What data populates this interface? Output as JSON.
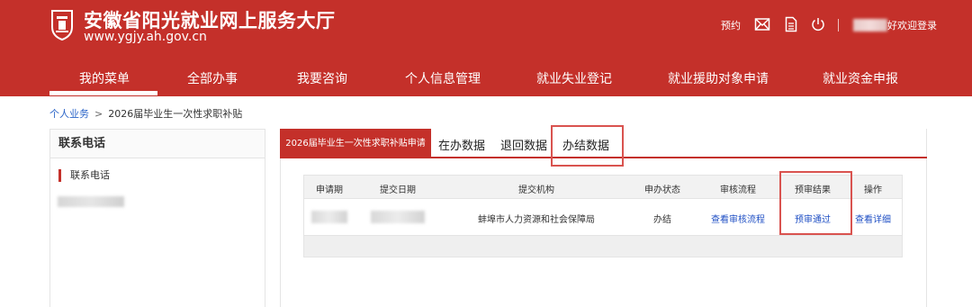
{
  "header": {
    "title": "安徽省阳光就业网上服务大厅",
    "url": "www.ygjy.ah.gov.cn",
    "appointment": "预约",
    "welcome_suffix": "好欢迎登录"
  },
  "nav": {
    "items": [
      "我的菜单",
      "全部办事",
      "我要咨询",
      "个人信息管理",
      "就业失业登记",
      "就业援助对象申请",
      "就业资金申报"
    ],
    "active_index": 0
  },
  "breadcrumb": {
    "root": "个人业务",
    "separator": ">",
    "current": "2026届毕业生一次性求职补贴"
  },
  "sidebar": {
    "title": "联系电话",
    "item": "联系电话"
  },
  "tabs": {
    "active": "2026届毕业生一次性求职补贴申请",
    "items": [
      "在办数据",
      "退回数据",
      "办结数据"
    ],
    "highlighted": "办结数据"
  },
  "table": {
    "columns": [
      "申请期",
      "提交日期",
      "提交机构",
      "申办状态",
      "审核流程",
      "预审结果",
      "操作"
    ],
    "rows": [
      {
        "org": "蚌埠市人力资源和社会保障局",
        "status": "办结",
        "flow": "查看审核流程",
        "result": "预审通过",
        "action": "查看详细"
      }
    ]
  },
  "colors": {
    "brand_red": "#c4302a",
    "link_blue": "#1f4fc4",
    "highlight_box": "#d9534f"
  }
}
